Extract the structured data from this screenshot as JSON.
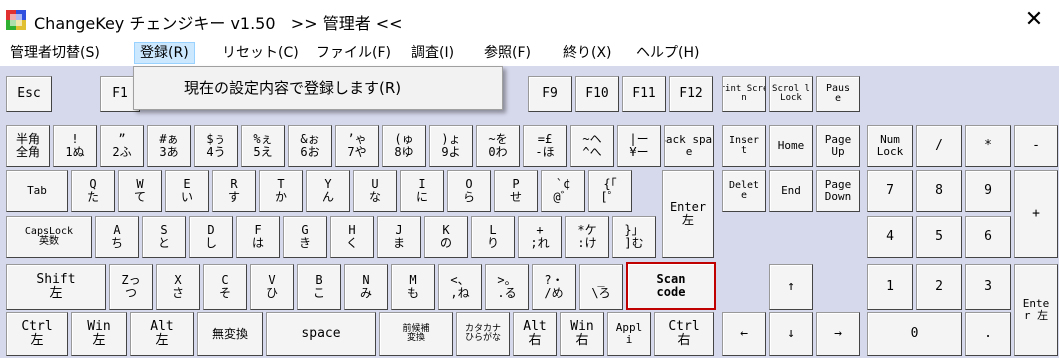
{
  "window": {
    "title": "ChangeKey チェンジキー v1.50   >> 管理者 <<",
    "close_glyph": "✕"
  },
  "menu": [
    {
      "label": "管理者切替(S)"
    },
    {
      "label": "登録(R)"
    },
    {
      "label": "リセット(C)"
    },
    {
      "label": "ファイル(F)"
    },
    {
      "label": "調査(I)"
    },
    {
      "label": "参照(F)"
    },
    {
      "label": "終り(X)"
    },
    {
      "label": "ヘルプ(H)"
    }
  ],
  "dropdown": {
    "item": "現在の設定内容で登録します(R)"
  },
  "keys": [
    {
      "l1": "Esc",
      "l2": ""
    },
    {
      "l1": "F1",
      "l2": ""
    },
    {
      "l1": "F9",
      "l2": ""
    },
    {
      "l1": "F10",
      "l2": ""
    },
    {
      "l1": "F11",
      "l2": ""
    },
    {
      "l1": "F12",
      "l2": ""
    },
    {
      "l1": "Print Scree",
      "l2": "n"
    },
    {
      "l1": "Scrol l",
      "l2": "Lock"
    },
    {
      "l1": "Paus",
      "l2": "e"
    },
    {
      "l1": "半角",
      "l2": "全角"
    },
    {
      "l1": "!",
      "l2": "1ぬ"
    },
    {
      "l1": "”",
      "l2": "2ふ"
    },
    {
      "l1": "#ぁ",
      "l2": "3あ"
    },
    {
      "l1": "$ぅ",
      "l2": "4う"
    },
    {
      "l1": "%ぇ",
      "l2": "5え"
    },
    {
      "l1": "&ぉ",
      "l2": "6お"
    },
    {
      "l1": "’ゃ",
      "l2": "7や"
    },
    {
      "l1": "(ゅ",
      "l2": "8ゆ"
    },
    {
      "l1": ")ょ",
      "l2": "9よ"
    },
    {
      "l1": "~を",
      "l2": "0わ"
    },
    {
      "l1": "=£",
      "l2": "-ほ"
    },
    {
      "l1": "~ヘ",
      "l2": "^へ"
    },
    {
      "l1": "|ー",
      "l2": "¥ー"
    },
    {
      "l1": "Back spac",
      "l2": "e"
    },
    {
      "l1": "Inser",
      "l2": "t"
    },
    {
      "l1": "Home",
      "l2": ""
    },
    {
      "l1": "Page",
      "l2": "Up"
    },
    {
      "l1": "Num",
      "l2": "Lock"
    },
    {
      "l1": "/",
      "l2": ""
    },
    {
      "l1": "*",
      "l2": ""
    },
    {
      "l1": "-",
      "l2": ""
    },
    {
      "l1": "Tab",
      "l2": ""
    },
    {
      "l1": "Q",
      "l2": "た"
    },
    {
      "l1": "W",
      "l2": "て"
    },
    {
      "l1": "E",
      "l2": "い"
    },
    {
      "l1": "R",
      "l2": "す"
    },
    {
      "l1": "T",
      "l2": "か"
    },
    {
      "l1": "Y",
      "l2": "ん"
    },
    {
      "l1": "U",
      "l2": "な"
    },
    {
      "l1": "I",
      "l2": "に"
    },
    {
      "l1": "O",
      "l2": "ら"
    },
    {
      "l1": "P",
      "l2": "せ"
    },
    {
      "l1": "`¢",
      "l2": "@゛"
    },
    {
      "l1": "{「",
      "l2": "[゜"
    },
    {
      "l1": "Enter",
      "l2": "左"
    },
    {
      "l1": "Delet",
      "l2": "e"
    },
    {
      "l1": "End",
      "l2": ""
    },
    {
      "l1": "Page",
      "l2": "Down"
    },
    {
      "l1": "7",
      "l2": ""
    },
    {
      "l1": "8",
      "l2": ""
    },
    {
      "l1": "9",
      "l2": ""
    },
    {
      "l1": "+",
      "l2": ""
    },
    {
      "l1": "CapsLock",
      "l2": "英数"
    },
    {
      "l1": "A",
      "l2": "ち"
    },
    {
      "l1": "S",
      "l2": "と"
    },
    {
      "l1": "D",
      "l2": "し"
    },
    {
      "l1": "F",
      "l2": "は"
    },
    {
      "l1": "G",
      "l2": "き"
    },
    {
      "l1": "H",
      "l2": "く"
    },
    {
      "l1": "J",
      "l2": "ま"
    },
    {
      "l1": "K",
      "l2": "の"
    },
    {
      "l1": "L",
      "l2": "り"
    },
    {
      "l1": "+",
      "l2": ";れ"
    },
    {
      "l1": "*ケ",
      "l2": ":け"
    },
    {
      "l1": "}」",
      "l2": "]む"
    },
    {
      "l1": "4",
      "l2": ""
    },
    {
      "l1": "5",
      "l2": ""
    },
    {
      "l1": "6",
      "l2": ""
    },
    {
      "l1": "Shift",
      "l2": "左"
    },
    {
      "l1": "Zっ",
      "l2": "つ"
    },
    {
      "l1": "X",
      "l2": "さ"
    },
    {
      "l1": "C",
      "l2": "そ"
    },
    {
      "l1": "V",
      "l2": "ひ"
    },
    {
      "l1": "B",
      "l2": "こ"
    },
    {
      "l1": "N",
      "l2": "み"
    },
    {
      "l1": "M",
      "l2": "も"
    },
    {
      "l1": "<、",
      "l2": ",ね"
    },
    {
      "l1": ">。",
      "l2": ".る"
    },
    {
      "l1": "?・",
      "l2": "/め"
    },
    {
      "l1": "_",
      "l2": "\\ろ"
    },
    {
      "l1": "Scan",
      "l2": "code"
    },
    {
      "l1": "↑",
      "l2": ""
    },
    {
      "l1": "1",
      "l2": ""
    },
    {
      "l1": "2",
      "l2": ""
    },
    {
      "l1": "3",
      "l2": ""
    },
    {
      "l1": "Ente",
      "l2": "r 左"
    },
    {
      "l1": "Ctrl",
      "l2": "左"
    },
    {
      "l1": "Win",
      "l2": "左"
    },
    {
      "l1": "Alt",
      "l2": "左"
    },
    {
      "l1": "無変換",
      "l2": ""
    },
    {
      "l1": "space",
      "l2": ""
    },
    {
      "l1": "前候補",
      "l2": "変換"
    },
    {
      "l1": "カタカナ",
      "l2": "ひらがな"
    },
    {
      "l1": "Alt",
      "l2": "右"
    },
    {
      "l1": "Win",
      "l2": "右"
    },
    {
      "l1": "Appl",
      "l2": "i"
    },
    {
      "l1": "Ctrl",
      "l2": "右"
    },
    {
      "l1": "←",
      "l2": ""
    },
    {
      "l1": "↓",
      "l2": ""
    },
    {
      "l1": "→",
      "l2": ""
    },
    {
      "l1": "0",
      "l2": ""
    },
    {
      "l1": ".",
      "l2": ""
    }
  ]
}
